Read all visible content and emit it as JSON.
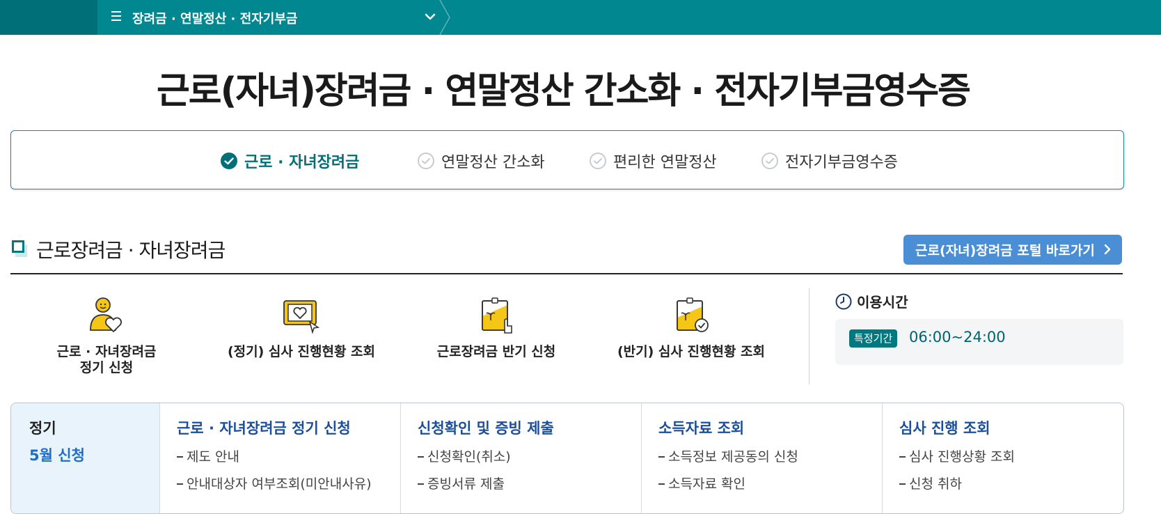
{
  "topbar": {
    "menu_label": "장려금 · 연말정산 · 전자기부금",
    "icons": {
      "menu": "hamburger-icon",
      "toggle": "chevron-down-icon"
    }
  },
  "page_title": "근로(자녀)장려금 · 연말정산 간소화 · 전자기부금영수증",
  "tabs": [
    {
      "label": "근로 · 자녀장려금",
      "active": true
    },
    {
      "label": "연말정산 간소화",
      "active": false
    },
    {
      "label": "편리한 연말정산",
      "active": false
    },
    {
      "label": "전자기부금영수증",
      "active": false
    }
  ],
  "section": {
    "title": "근로장려금 · 자녀장려금",
    "portal_button": "근로(자녀)장려금 포털 바로가기"
  },
  "quick_links": [
    {
      "line1": "근로 · 자녀장려금",
      "line2": "정기 신청",
      "icon": "person-heart-icon"
    },
    {
      "line1": "(정기) 심사 진행현황 조회",
      "line2": "",
      "icon": "monitor-heart-icon"
    },
    {
      "line1": "근로장려금 반기 신청",
      "line2": "",
      "icon": "document-click-icon"
    },
    {
      "line1": "(반기) 심사 진행현황 조회",
      "line2": "",
      "icon": "document-check-icon"
    }
  ],
  "hours": {
    "title": "이용시간",
    "badge": "특정기간",
    "value": "06:00~24:00"
  },
  "periods": {
    "first_title": "정기",
    "first_sub": "5월 신청",
    "columns": [
      {
        "title": "근로 · 자녀장려금 정기 신청",
        "items": [
          "제도 안내",
          "안내대상자 여부조회(미안내사유)"
        ]
      },
      {
        "title": "신청확인 및 증빙 제출",
        "items": [
          "신청확인(취소)",
          "증빙서류 제출"
        ]
      },
      {
        "title": "소득자료 조회",
        "items": [
          "소득정보 제공동의 신청",
          "소득자료 확인"
        ]
      },
      {
        "title": "심사 진행 조회",
        "items": [
          "심사 진행상황 조회",
          "신청 취하"
        ]
      }
    ]
  },
  "colors": {
    "topbar": "#00878f",
    "topbar_dark": "#006f77",
    "accent": "#006f77",
    "portal_button": "#4a8fd6",
    "period_title": "#1b4e9b",
    "period_sub": "#1e6ec8",
    "icon_yellow": "#f5c518"
  }
}
